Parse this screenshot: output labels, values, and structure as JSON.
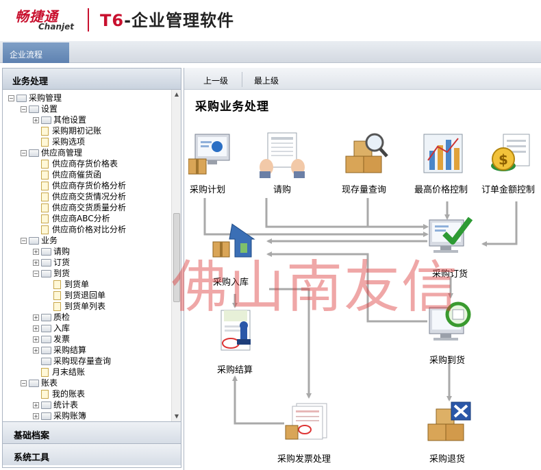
{
  "header": {
    "brand_cn": "畅捷通",
    "brand_en": "Chanjet",
    "product_t6": "T6",
    "product_rest": "-企业管理软件"
  },
  "top_tabs": {
    "flow": "企业流程"
  },
  "left_panel": {
    "title": "业务处理",
    "bottom_tabs": [
      "基础档案",
      "系统工具"
    ],
    "tree": [
      {
        "level": 0,
        "expander": "-",
        "icon": "folder",
        "label": "采购管理"
      },
      {
        "level": 1,
        "expander": "-",
        "icon": "folder",
        "label": "设置"
      },
      {
        "level": 2,
        "expander": "+",
        "icon": "folder",
        "label": "其他设置"
      },
      {
        "level": 2,
        "expander": "",
        "icon": "page",
        "label": "采购期初记账"
      },
      {
        "level": 2,
        "expander": "",
        "icon": "page",
        "label": "采购选项"
      },
      {
        "level": 1,
        "expander": "-",
        "icon": "folder",
        "label": "供应商管理"
      },
      {
        "level": 2,
        "expander": "",
        "icon": "page",
        "label": "供应商存货价格表"
      },
      {
        "level": 2,
        "expander": "",
        "icon": "page",
        "label": "供应商催货函"
      },
      {
        "level": 2,
        "expander": "",
        "icon": "page",
        "label": "供应商存货价格分析"
      },
      {
        "level": 2,
        "expander": "",
        "icon": "page",
        "label": "供应商交货情况分析"
      },
      {
        "level": 2,
        "expander": "",
        "icon": "page",
        "label": "供应商交货质量分析"
      },
      {
        "level": 2,
        "expander": "",
        "icon": "page",
        "label": "供应商ABC分析"
      },
      {
        "level": 2,
        "expander": "",
        "icon": "page",
        "label": "供应商价格对比分析"
      },
      {
        "level": 1,
        "expander": "-",
        "icon": "folder",
        "label": "业务"
      },
      {
        "level": 2,
        "expander": "+",
        "icon": "folder",
        "label": "请购"
      },
      {
        "level": 2,
        "expander": "+",
        "icon": "folder",
        "label": "订货"
      },
      {
        "level": 2,
        "expander": "-",
        "icon": "folder",
        "label": "到货"
      },
      {
        "level": 3,
        "expander": "",
        "icon": "page",
        "label": "到货单"
      },
      {
        "level": 3,
        "expander": "",
        "icon": "page",
        "label": "到货退回单"
      },
      {
        "level": 3,
        "expander": "",
        "icon": "page",
        "label": "到货单列表"
      },
      {
        "level": 2,
        "expander": "+",
        "icon": "folder",
        "label": "质检"
      },
      {
        "level": 2,
        "expander": "+",
        "icon": "folder",
        "label": "入库"
      },
      {
        "level": 2,
        "expander": "+",
        "icon": "folder",
        "label": "发票"
      },
      {
        "level": 2,
        "expander": "+",
        "icon": "folder",
        "label": "采购结算"
      },
      {
        "level": 2,
        "expander": "",
        "icon": "folder",
        "label": "采购现存量查询"
      },
      {
        "level": 2,
        "expander": "",
        "icon": "page",
        "label": "月末结账"
      },
      {
        "level": 1,
        "expander": "-",
        "icon": "folder",
        "label": "账表"
      },
      {
        "level": 2,
        "expander": "",
        "icon": "page",
        "label": "我的账表"
      },
      {
        "level": 2,
        "expander": "+",
        "icon": "folder",
        "label": "统计表"
      },
      {
        "level": 2,
        "expander": "+",
        "icon": "folder",
        "label": "采购账簿"
      }
    ]
  },
  "right_panel": {
    "nav_up": "上一级",
    "nav_top": "最上级",
    "title": "采购业务处理",
    "nodes": {
      "plan": {
        "label": "采购计划",
        "icon": "monitor-chart-icon"
      },
      "request": {
        "label": "请购",
        "icon": "document-hands-icon"
      },
      "stock_query": {
        "label": "现存量查询",
        "icon": "magnifier-boxes-icon"
      },
      "max_price": {
        "label": "最高价格控制",
        "icon": "bar-chart-icon"
      },
      "order_amount": {
        "label": "订单金额控制",
        "icon": "money-coin-icon"
      },
      "purchase_inbound": {
        "label": "采购入库",
        "icon": "warehouse-icon"
      },
      "purchase_order": {
        "label": "采购订货",
        "icon": "checkmark-monitor-icon"
      },
      "purchase_settle": {
        "label": "采购结算",
        "icon": "stamp-document-icon"
      },
      "purchase_arrival": {
        "label": "采购到货",
        "icon": "arrival-monitor-icon"
      },
      "invoice": {
        "label": "采购发票处理",
        "icon": "invoice-icon"
      },
      "purchase_return": {
        "label": "采购退货",
        "icon": "return-boxes-icon"
      }
    }
  },
  "watermark": "佛山南友信",
  "colors": {
    "brand_red": "#c8102e",
    "tab_blue": "#5e82b1",
    "arrow_gray": "#a9a9a9"
  }
}
